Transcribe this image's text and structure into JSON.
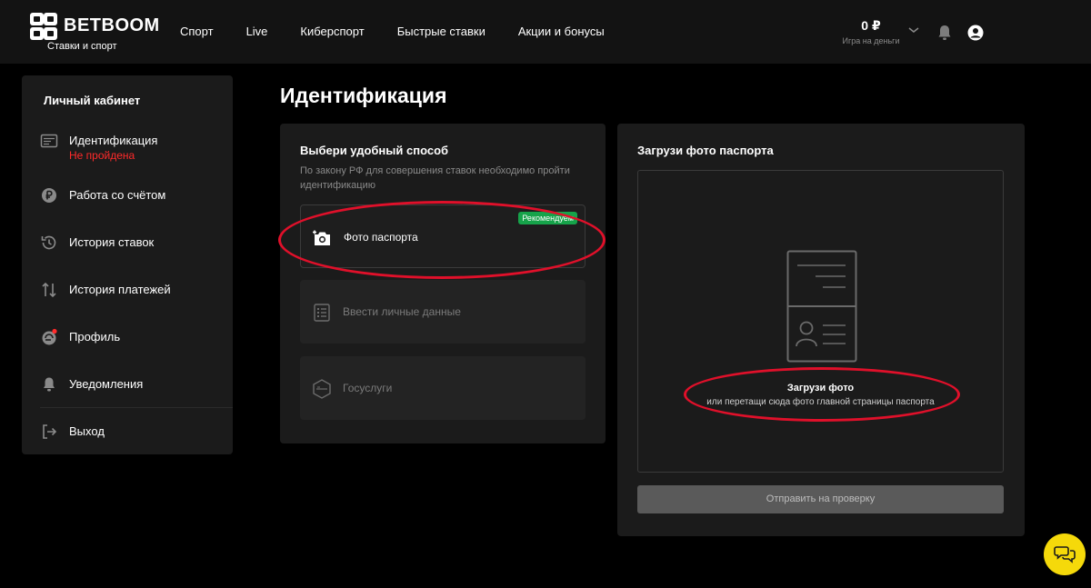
{
  "header": {
    "brand": "BETBOOM",
    "brand_sub": "Ставки и спорт",
    "nav": [
      "Спорт",
      "Live",
      "Киберспорт",
      "Быстрые ставки",
      "Акции и бонусы"
    ],
    "balance_amount": "0 ₽",
    "balance_label": "Игра на деньги"
  },
  "sidebar": {
    "title": "Личный кабинет",
    "items": [
      {
        "label": "Идентификация",
        "sub": "Не пройдена",
        "icon": "id-card-icon"
      },
      {
        "label": "Работа со счётом",
        "icon": "ruble-coin-icon"
      },
      {
        "label": "История ставок",
        "icon": "history-icon"
      },
      {
        "label": "История платежей",
        "icon": "transfer-arrows-icon"
      },
      {
        "label": "Профиль",
        "icon": "profile-icon"
      },
      {
        "label": "Уведомления",
        "icon": "bell-icon"
      },
      {
        "label": "Выход",
        "icon": "logout-icon"
      }
    ]
  },
  "page": {
    "title": "Идентификация"
  },
  "method_card": {
    "heading": "Выбери удобный способ",
    "description": "По закону РФ для совершения ставок необходимо пройти идентификацию",
    "options": [
      {
        "label": "Фото паспорта",
        "badge": "Рекомендуем",
        "icon": "camera-add-icon"
      },
      {
        "label": "Ввести личные данные",
        "icon": "form-list-icon"
      },
      {
        "label": "Госуслуги",
        "icon": "gosuslugi-icon"
      }
    ]
  },
  "upload_card": {
    "heading": "Загрузи фото паспорта",
    "drop_title": "Загрузи фото",
    "drop_hint": "или перетащи сюда фото главной страницы паспорта",
    "submit_label": "Отправить на проверку"
  },
  "colors": {
    "background": "#000000",
    "panel": "#1b1b1b",
    "error": "#ff2a2a",
    "badge": "#16a34a",
    "annotation": "#e0102a",
    "chat": "#f5d90a"
  }
}
